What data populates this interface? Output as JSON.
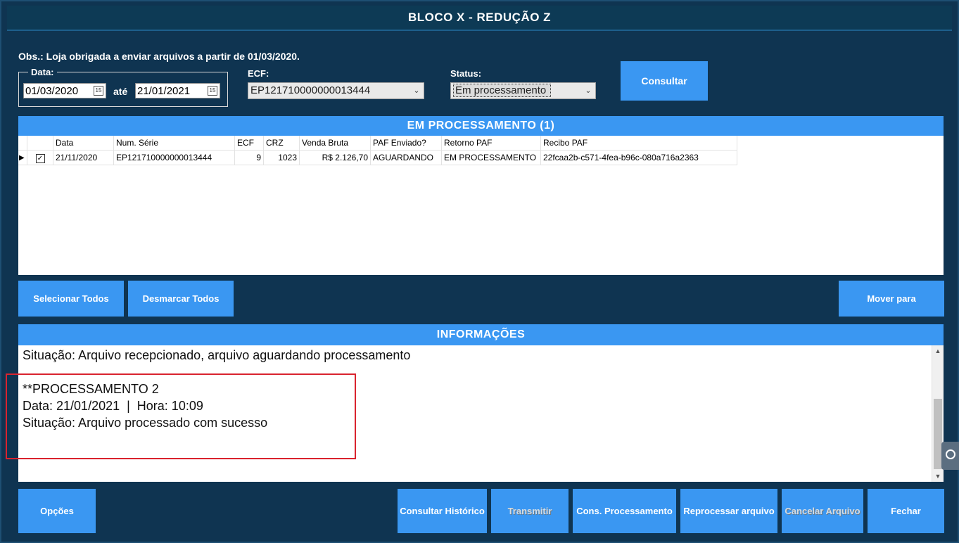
{
  "title": "BLOCO X - REDUÇÃO Z",
  "obs": "Obs.: Loja obrigada a enviar arquivos a partir de 01/03/2020.",
  "filters": {
    "data_label": "Data:",
    "date_from": "01/03/2020",
    "ate_label": "até",
    "date_to": "21/01/2021",
    "ecf_label": "ECF:",
    "ecf_value": "EP121710000000013444",
    "status_label": "Status:",
    "status_value": "Em processamento",
    "consultar_label": "Consultar"
  },
  "grid": {
    "header": "EM PROCESSAMENTO (1)",
    "columns": [
      "Data",
      "Num. Série",
      "ECF",
      "CRZ",
      "Venda Bruta",
      "PAF Enviado?",
      "Retorno PAF",
      "Recibo PAF"
    ],
    "rows": [
      {
        "data": "21/11/2020",
        "num_serie": "EP121710000000013444",
        "ecf": "9",
        "crz": "1023",
        "venda_bruta": "R$ 2.126,70",
        "paf_enviado": "AGUARDANDO",
        "retorno_paf": "EM PROCESSAMENTO",
        "recibo_paf": "22fcaa2b-c571-4fea-b96c-080a716a2363",
        "checked": true
      }
    ]
  },
  "mid_buttons": {
    "selecionar_todos": "Selecionar Todos",
    "desmarcar_todos": "Desmarcar Todos",
    "mover_para": "Mover para"
  },
  "info": {
    "header": "INFORMAÇÕES",
    "lines": [
      "Situação: Arquivo recepcionado, arquivo aguardando processamento",
      "**PROCESSAMENTO 2",
      "Data: 21/01/2021  |  Hora: 10:09",
      "Situação: Arquivo processado com sucesso"
    ]
  },
  "bottom_buttons": {
    "opcoes": "Opções",
    "consultar_historico": "Consultar Histórico",
    "transmitir": "Transmitir",
    "cons_processamento": "Cons. Processamento",
    "reprocessar_arquivo": "Reprocessar arquivo",
    "cancelar_arquivo": "Cancelar Arquivo",
    "fechar": "Fechar"
  },
  "colors": {
    "background": "#0f3451",
    "accent": "#3a97f2",
    "highlight": "#d9232e"
  }
}
